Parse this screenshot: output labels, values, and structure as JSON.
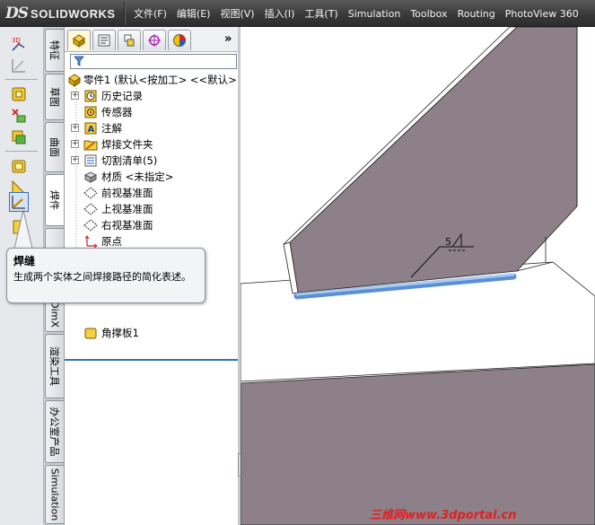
{
  "app": {
    "brand_mark": "DS",
    "brand_name": "SOLIDWORKS"
  },
  "menu": [
    "文件(F)",
    "编辑(E)",
    "视图(V)",
    "插入(I)",
    "工具(T)",
    "Simulation",
    "Toolbox",
    "Routing",
    "PhotoView 360"
  ],
  "side_tabs": {
    "features": "特征",
    "sketch": "草图",
    "surfaces": "曲面",
    "weldments": "焊件",
    "dimxpert_partial": "DimX",
    "render_tools": "渲染工具",
    "office_products": "办公室产品",
    "simulation": "Simulation"
  },
  "tree": {
    "root": "零件1  (默认<按加工> <<默认>",
    "items": [
      {
        "label": "历史记录",
        "icon": "history-icon",
        "expandable": true
      },
      {
        "label": "传感器",
        "icon": "sensor-icon",
        "expandable": false
      },
      {
        "label": "注解",
        "icon": "annotation-icon",
        "expandable": true
      },
      {
        "label": "焊接文件夹",
        "icon": "weld-folder-icon",
        "expandable": true
      },
      {
        "label": "切割清单(5)",
        "icon": "cut-list-icon",
        "expandable": true
      },
      {
        "label": "材质 <未指定>",
        "icon": "material-icon",
        "expandable": false
      },
      {
        "label": "前视基准面",
        "icon": "plane-icon",
        "expandable": false
      },
      {
        "label": "上视基准面",
        "icon": "plane-icon",
        "expandable": false
      },
      {
        "label": "右视基准面",
        "icon": "plane-icon",
        "expandable": false
      },
      {
        "label": "原点",
        "icon": "origin-icon",
        "expandable": false
      }
    ],
    "last_item": "角撑板1"
  },
  "tooltip": {
    "title": "焊缝",
    "description": "生成两个实体之间焊接路径的简化表述。"
  },
  "weld_symbol": {
    "size": "5"
  },
  "watermark": "三维网www.3dportal.cn",
  "colors": {
    "part_face": "#8d8088",
    "weld_bead": "#a9c9ee",
    "selection": "#3a6fb5",
    "watermark": "#e02020"
  }
}
